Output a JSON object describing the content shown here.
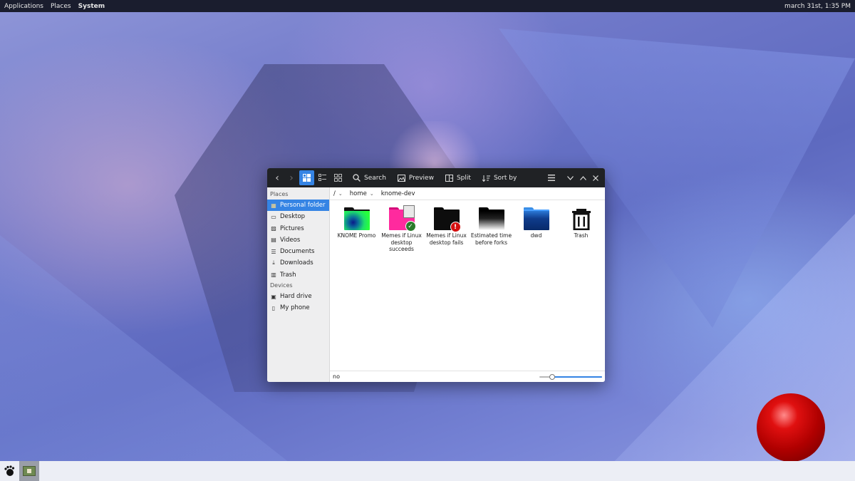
{
  "top_panel": {
    "menus": [
      "Applications",
      "Places",
      "System"
    ],
    "clock": "march 31st, 1:35 PM"
  },
  "window": {
    "toolbar": {
      "search_label": "Search",
      "preview_label": "Preview",
      "split_label": "Split",
      "sort_label": "Sort by"
    },
    "sidebar": {
      "places_header": "Places",
      "places": [
        {
          "label": "Personal folder",
          "icon": "home-folder-icon",
          "active": true
        },
        {
          "label": "Desktop",
          "icon": "desktop-icon"
        },
        {
          "label": "Pictures",
          "icon": "pictures-icon"
        },
        {
          "label": "Videos",
          "icon": "videos-icon"
        },
        {
          "label": "Documents",
          "icon": "documents-icon"
        },
        {
          "label": "Downloads",
          "icon": "downloads-icon"
        },
        {
          "label": "Trash",
          "icon": "trash-icon"
        }
      ],
      "devices_header": "Devices",
      "devices": [
        {
          "label": "Hard drive",
          "icon": "hard-drive-icon"
        },
        {
          "label": "My phone",
          "icon": "phone-icon"
        }
      ]
    },
    "path": [
      {
        "label": "/"
      },
      {
        "label": "home"
      },
      {
        "label": "knome-dev"
      }
    ],
    "files": [
      {
        "label": "KNOME Promo",
        "type": "folder-gradient-green"
      },
      {
        "label": "Memes if Linux desktop succeeds",
        "type": "folder-pink-check"
      },
      {
        "label": "Memes if Linux desktop fails",
        "type": "folder-black-error"
      },
      {
        "label": "Estimated time before forks",
        "type": "folder-black-fade"
      },
      {
        "label": "dwd",
        "type": "folder-blue"
      },
      {
        "label": "Trash",
        "type": "trash"
      }
    ],
    "status_text": "no",
    "zoom_level": 0.18
  },
  "colors": {
    "accent": "#3584e4",
    "toolbar_bg": "#202225",
    "sidebar_bg": "#eeeeef"
  }
}
